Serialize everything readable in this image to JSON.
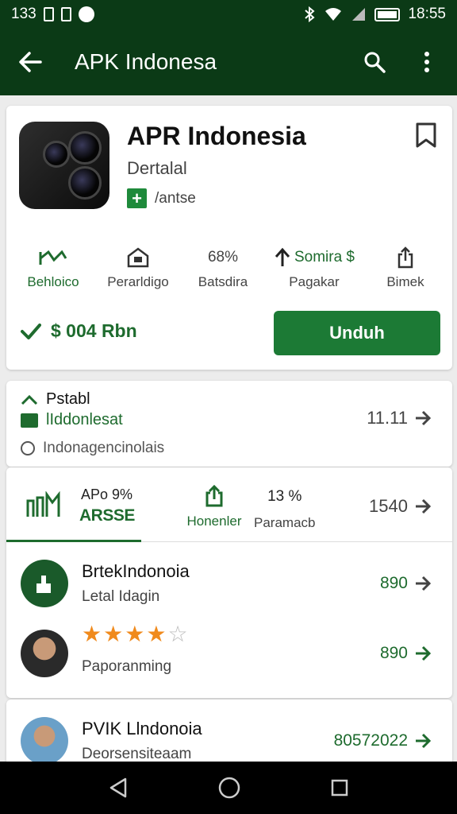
{
  "status_bar": {
    "left_text": "133",
    "time": "18:55"
  },
  "toolbar": {
    "title": "APK Indonesa"
  },
  "app": {
    "name": "APR Indonesia",
    "developer": "Dertalal",
    "badge_text": "/antse",
    "stats": [
      {
        "top": "",
        "label": "Behloico"
      },
      {
        "top": "",
        "label": "Perarldigo"
      },
      {
        "top": "68%",
        "label": "Batsdira"
      },
      {
        "top": "Somira $",
        "label": "Pagakar"
      },
      {
        "top": "",
        "label": "Bimek"
      }
    ],
    "price": "$ 004 Rbn",
    "download_label": "Unduh",
    "accent_color": "#1c7a35"
  },
  "info": {
    "line1": "Pstabl",
    "line2": "lIddonlesat",
    "line3": "Indonagencinolais",
    "right_value": "11.11"
  },
  "tabs": {
    "tab_a_line1": "APo 9%",
    "tab_a_line2": "ARSSE",
    "tab_b_label": "Honenler",
    "tab_c_value": "13 %",
    "tab_c_label": "Paramacb",
    "right_value": "1540"
  },
  "rows": [
    {
      "name": "BrtekIndonoia",
      "sub": "Letal Idagin",
      "value": "890"
    },
    {
      "name": "",
      "sub": "Paporanming",
      "value": "890",
      "rating": 4
    }
  ],
  "last_row": {
    "name": "PVIK Llndonoia",
    "sub": "Deorsensiteaam",
    "value": "80572022"
  }
}
